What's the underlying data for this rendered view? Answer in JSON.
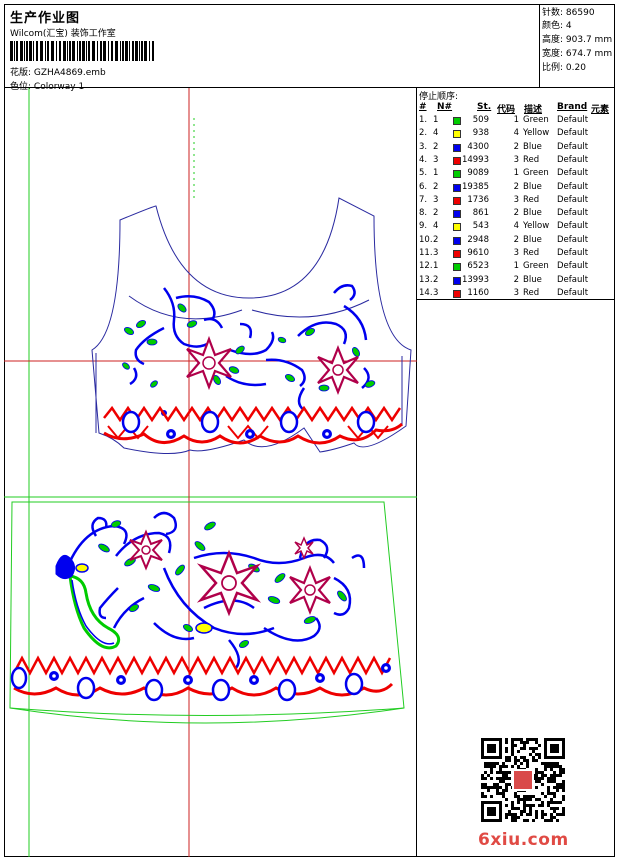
{
  "header": {
    "title": "生产作业图",
    "studio": "Wilcom(汇宝) 装饰工作室",
    "design_label": "花版:",
    "design_file": "GZHA4869.emb",
    "colorway_label": "色位:",
    "colorway": "Colorway 1"
  },
  "stats": [
    {
      "label": "针数:",
      "value": "86590"
    },
    {
      "label": "颜色:",
      "value": "4"
    },
    {
      "label": "高度:",
      "value": "903.7 mm"
    },
    {
      "label": "宽度:",
      "value": "674.7 mm"
    },
    {
      "label": "比例:",
      "value": "0.20"
    }
  ],
  "stop_sequence": {
    "title": "停止顺序:",
    "headers": [
      "#",
      "N#",
      "St.",
      "代码",
      "描述",
      "Brand",
      "元素"
    ],
    "rows": [
      {
        "idx": "1.",
        "n": "1",
        "st": "509",
        "code": "1",
        "desc": "Green",
        "brand": "Default",
        "color": "#00cc00"
      },
      {
        "idx": "2.",
        "n": "4",
        "st": "938",
        "code": "4",
        "desc": "Yellow",
        "brand": "Default",
        "color": "#ffff00"
      },
      {
        "idx": "3.",
        "n": "2",
        "st": "4300",
        "code": "2",
        "desc": "Blue",
        "brand": "Default",
        "color": "#0000ee"
      },
      {
        "idx": "4.",
        "n": "3",
        "st": "14993",
        "code": "3",
        "desc": "Red",
        "brand": "Default",
        "color": "#ee0000"
      },
      {
        "idx": "5.",
        "n": "1",
        "st": "9089",
        "code": "1",
        "desc": "Green",
        "brand": "Default",
        "color": "#00cc00"
      },
      {
        "idx": "6.",
        "n": "2",
        "st": "19385",
        "code": "2",
        "desc": "Blue",
        "brand": "Default",
        "color": "#0000ee"
      },
      {
        "idx": "7.",
        "n": "3",
        "st": "1736",
        "code": "3",
        "desc": "Red",
        "brand": "Default",
        "color": "#ee0000"
      },
      {
        "idx": "8.",
        "n": "2",
        "st": "861",
        "code": "2",
        "desc": "Blue",
        "brand": "Default",
        "color": "#0000ee"
      },
      {
        "idx": "9.",
        "n": "4",
        "st": "543",
        "code": "4",
        "desc": "Yellow",
        "brand": "Default",
        "color": "#ffff00"
      },
      {
        "idx": "10.",
        "n": "2",
        "st": "2948",
        "code": "2",
        "desc": "Blue",
        "brand": "Default",
        "color": "#0000ee"
      },
      {
        "idx": "11.",
        "n": "3",
        "st": "9610",
        "code": "3",
        "desc": "Red",
        "brand": "Default",
        "color": "#ee0000"
      },
      {
        "idx": "12.",
        "n": "1",
        "st": "6523",
        "code": "1",
        "desc": "Green",
        "brand": "Default",
        "color": "#00cc00"
      },
      {
        "idx": "13.",
        "n": "2",
        "st": "13993",
        "code": "2",
        "desc": "Blue",
        "brand": "Default",
        "color": "#0000ee"
      },
      {
        "idx": "14.",
        "n": "3",
        "st": "1160",
        "code": "3",
        "desc": "Red",
        "brand": "Default",
        "color": "#ee0000"
      }
    ]
  },
  "watermark": "6xiu.com",
  "colors": {
    "green": "#00cc00",
    "blue": "#0000ee",
    "red": "#ee0000",
    "yellow": "#ffff00",
    "maroon": "#b0004a",
    "outline": "#2a2aa0",
    "guide_green": "#22cc22",
    "guide_red": "#cc2222"
  }
}
